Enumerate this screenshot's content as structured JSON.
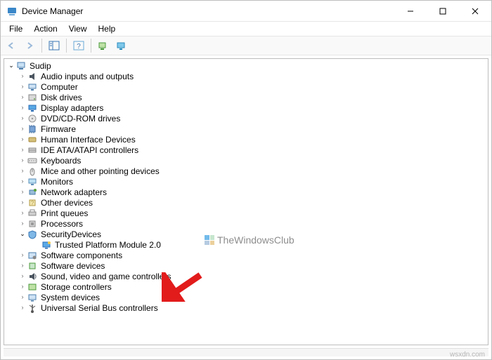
{
  "window": {
    "title": "Device Manager"
  },
  "menu": {
    "file": "File",
    "action": "Action",
    "view": "View",
    "help": "Help"
  },
  "toolbar": {
    "back": "back-icon",
    "forward": "forward-icon",
    "show_hide": "show-hide-tree-icon",
    "properties": "properties-icon",
    "help": "help-icon",
    "devices": "devices-icon"
  },
  "root": {
    "label": "Sudip"
  },
  "categories": [
    {
      "id": "audio",
      "label": "Audio inputs and outputs",
      "icon": "speaker"
    },
    {
      "id": "computer",
      "label": "Computer",
      "icon": "computer"
    },
    {
      "id": "disk",
      "label": "Disk drives",
      "icon": "disk"
    },
    {
      "id": "display",
      "label": "Display adapters",
      "icon": "display"
    },
    {
      "id": "dvd",
      "label": "DVD/CD-ROM drives",
      "icon": "optical"
    },
    {
      "id": "firmware",
      "label": "Firmware",
      "icon": "chip"
    },
    {
      "id": "hid",
      "label": "Human Interface Devices",
      "icon": "hid"
    },
    {
      "id": "ide",
      "label": "IDE ATA/ATAPI controllers",
      "icon": "ide"
    },
    {
      "id": "keyboard",
      "label": "Keyboards",
      "icon": "keyboard"
    },
    {
      "id": "mouse",
      "label": "Mice and other pointing devices",
      "icon": "mouse"
    },
    {
      "id": "monitor",
      "label": "Monitors",
      "icon": "monitor"
    },
    {
      "id": "network",
      "label": "Network adapters",
      "icon": "network"
    },
    {
      "id": "other",
      "label": "Other devices",
      "icon": "other"
    },
    {
      "id": "print",
      "label": "Print queues",
      "icon": "print"
    },
    {
      "id": "cpu",
      "label": "Processors",
      "icon": "cpu"
    },
    {
      "id": "security",
      "label": "SecurityDevices",
      "icon": "security",
      "expanded": true,
      "children": [
        {
          "id": "tpm",
          "label": "Trusted Platform Module 2.0",
          "icon": "tpm"
        }
      ]
    },
    {
      "id": "swcomp",
      "label": "Software components",
      "icon": "swcomp"
    },
    {
      "id": "swdev",
      "label": "Software devices",
      "icon": "swdev"
    },
    {
      "id": "sound",
      "label": "Sound, video and game controllers",
      "icon": "sound"
    },
    {
      "id": "storage",
      "label": "Storage controllers",
      "icon": "storage"
    },
    {
      "id": "system",
      "label": "System devices",
      "icon": "system"
    },
    {
      "id": "usb",
      "label": "Universal Serial Bus controllers",
      "icon": "usb"
    }
  ],
  "watermark": "TheWindowsClub",
  "credit": "wsxdn.com"
}
